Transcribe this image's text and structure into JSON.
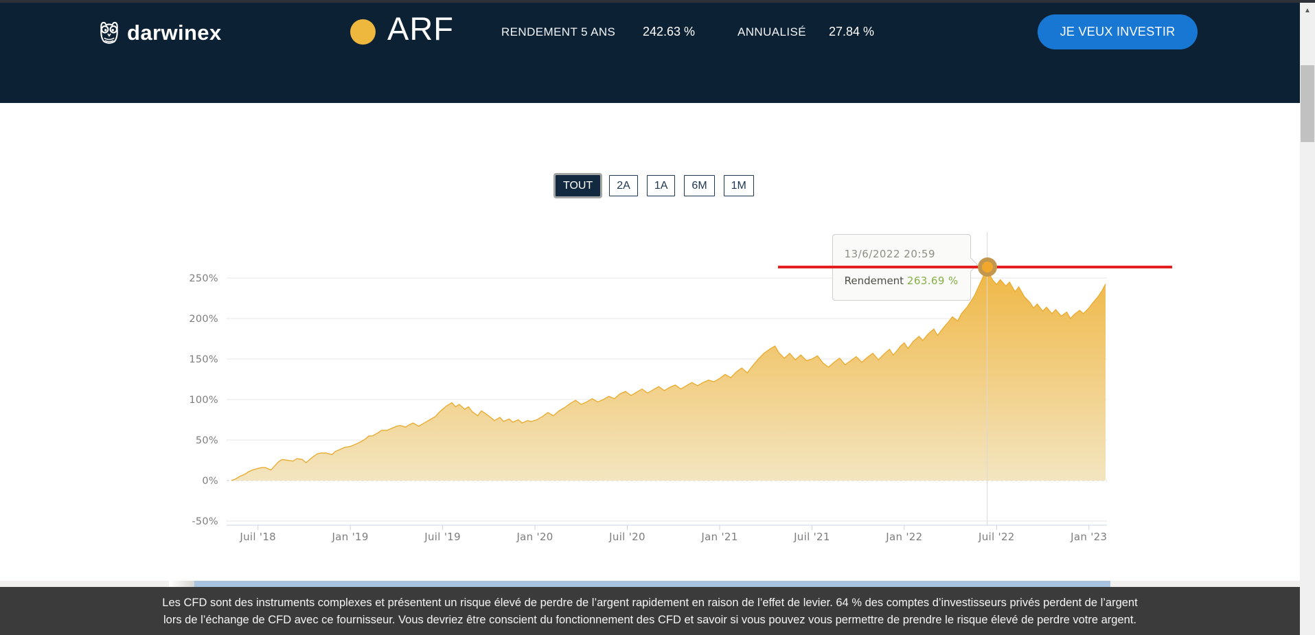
{
  "header": {
    "brand": "darwinex",
    "asset_symbol": "ARF",
    "stats": [
      {
        "label": "RENDEMENT 5 ANS",
        "value": "242.63 %"
      },
      {
        "label": "ANNUALISÉ",
        "value": "27.84 %"
      }
    ],
    "invest_button": "JE VEUX INVESTIR",
    "colors": {
      "header_bg": "#0d2134",
      "accent_gold": "#eeb73d",
      "button_blue": "#1877d2"
    }
  },
  "range_buttons": [
    {
      "label": "TOUT",
      "active": true
    },
    {
      "label": "2A",
      "active": false
    },
    {
      "label": "1A",
      "active": false
    },
    {
      "label": "6M",
      "active": false
    },
    {
      "label": "1M",
      "active": false
    }
  ],
  "chart_data": {
    "type": "area",
    "title": "",
    "xlabel": "",
    "ylabel": "",
    "grid": "horizontal",
    "zero_line": "dashed",
    "legend": "none",
    "ylim": [
      -55,
      305
    ],
    "x_axis": {
      "ticks": [
        {
          "t": 2018.5,
          "label": "Juil '18"
        },
        {
          "t": 2019.0,
          "label": "Jan '19"
        },
        {
          "t": 2019.5,
          "label": "Juil '19"
        },
        {
          "t": 2020.0,
          "label": "Jan '20"
        },
        {
          "t": 2020.5,
          "label": "Juil '20"
        },
        {
          "t": 2021.0,
          "label": "Jan '21"
        },
        {
          "t": 2021.5,
          "label": "Juil '21"
        },
        {
          "t": 2022.0,
          "label": "Jan '22"
        },
        {
          "t": 2022.5,
          "label": "Juil '22"
        },
        {
          "t": 2023.0,
          "label": "Jan '23"
        }
      ]
    },
    "y_axis": {
      "unit": "%",
      "ticks": [
        {
          "v": 250,
          "label": "250%"
        },
        {
          "v": 200,
          "label": "200%"
        },
        {
          "v": 150,
          "label": "150%"
        },
        {
          "v": 100,
          "label": "100%"
        },
        {
          "v": 50,
          "label": "50%"
        },
        {
          "v": 0,
          "label": "0%"
        },
        {
          "v": -50,
          "label": "-50%"
        }
      ]
    },
    "series": [
      {
        "name": "Rendement",
        "color": "#EEB73D",
        "points": [
          [
            2018.355,
            0
          ],
          [
            2018.38,
            2
          ],
          [
            2018.4,
            5
          ],
          [
            2018.43,
            8
          ],
          [
            2018.45,
            11
          ],
          [
            2018.47,
            13
          ],
          [
            2018.5,
            15
          ],
          [
            2018.52,
            16
          ],
          [
            2018.54,
            16
          ],
          [
            2018.57,
            13
          ],
          [
            2018.59,
            18
          ],
          [
            2018.61,
            23
          ],
          [
            2018.63,
            26
          ],
          [
            2018.66,
            25
          ],
          [
            2018.69,
            24
          ],
          [
            2018.71,
            27
          ],
          [
            2018.74,
            26
          ],
          [
            2018.76,
            22
          ],
          [
            2018.79,
            28
          ],
          [
            2018.82,
            33
          ],
          [
            2018.84,
            34
          ],
          [
            2018.87,
            34
          ],
          [
            2018.9,
            32
          ],
          [
            2018.92,
            36
          ],
          [
            2018.95,
            39
          ],
          [
            2018.97,
            41
          ],
          [
            2019.0,
            42
          ],
          [
            2019.03,
            45
          ],
          [
            2019.05,
            47
          ],
          [
            2019.08,
            51
          ],
          [
            2019.1,
            55
          ],
          [
            2019.12,
            55
          ],
          [
            2019.15,
            59
          ],
          [
            2019.17,
            62
          ],
          [
            2019.2,
            62
          ],
          [
            2019.23,
            65
          ],
          [
            2019.25,
            67
          ],
          [
            2019.27,
            68
          ],
          [
            2019.3,
            66
          ],
          [
            2019.32,
            69
          ],
          [
            2019.34,
            71
          ],
          [
            2019.37,
            67
          ],
          [
            2019.4,
            71
          ],
          [
            2019.43,
            75
          ],
          [
            2019.46,
            79
          ],
          [
            2019.48,
            84
          ],
          [
            2019.5,
            88
          ],
          [
            2019.52,
            92
          ],
          [
            2019.55,
            96
          ],
          [
            2019.57,
            91
          ],
          [
            2019.59,
            94
          ],
          [
            2019.62,
            88
          ],
          [
            2019.64,
            91
          ],
          [
            2019.66,
            85
          ],
          [
            2019.69,
            80
          ],
          [
            2019.71,
            86
          ],
          [
            2019.73,
            83
          ],
          [
            2019.76,
            78
          ],
          [
            2019.78,
            74
          ],
          [
            2019.81,
            78
          ],
          [
            2019.83,
            73
          ],
          [
            2019.86,
            76
          ],
          [
            2019.88,
            72
          ],
          [
            2019.91,
            75
          ],
          [
            2019.93,
            71
          ],
          [
            2019.96,
            74
          ],
          [
            2019.98,
            73
          ],
          [
            2020.01,
            75
          ],
          [
            2020.04,
            79
          ],
          [
            2020.07,
            84
          ],
          [
            2020.1,
            80
          ],
          [
            2020.13,
            86
          ],
          [
            2020.16,
            90
          ],
          [
            2020.19,
            95
          ],
          [
            2020.22,
            99
          ],
          [
            2020.25,
            94
          ],
          [
            2020.28,
            97
          ],
          [
            2020.31,
            101
          ],
          [
            2020.34,
            97
          ],
          [
            2020.37,
            100
          ],
          [
            2020.4,
            104
          ],
          [
            2020.43,
            101
          ],
          [
            2020.46,
            107
          ],
          [
            2020.49,
            110
          ],
          [
            2020.52,
            105
          ],
          [
            2020.55,
            109
          ],
          [
            2020.58,
            113
          ],
          [
            2020.61,
            108
          ],
          [
            2020.64,
            112
          ],
          [
            2020.67,
            116
          ],
          [
            2020.7,
            111
          ],
          [
            2020.73,
            115
          ],
          [
            2020.76,
            118
          ],
          [
            2020.79,
            113
          ],
          [
            2020.82,
            117
          ],
          [
            2020.85,
            121
          ],
          [
            2020.88,
            117
          ],
          [
            2020.91,
            121
          ],
          [
            2020.94,
            124
          ],
          [
            2020.97,
            122
          ],
          [
            2021.0,
            126
          ],
          [
            2021.03,
            131
          ],
          [
            2021.06,
            127
          ],
          [
            2021.09,
            134
          ],
          [
            2021.12,
            139
          ],
          [
            2021.15,
            133
          ],
          [
            2021.18,
            142
          ],
          [
            2021.21,
            150
          ],
          [
            2021.24,
            157
          ],
          [
            2021.27,
            162
          ],
          [
            2021.3,
            166
          ],
          [
            2021.32,
            158
          ],
          [
            2021.35,
            151
          ],
          [
            2021.38,
            157
          ],
          [
            2021.41,
            149
          ],
          [
            2021.44,
            155
          ],
          [
            2021.47,
            148
          ],
          [
            2021.5,
            150
          ],
          [
            2021.53,
            154
          ],
          [
            2021.56,
            145
          ],
          [
            2021.59,
            140
          ],
          [
            2021.62,
            146
          ],
          [
            2021.65,
            151
          ],
          [
            2021.68,
            143
          ],
          [
            2021.71,
            148
          ],
          [
            2021.74,
            153
          ],
          [
            2021.77,
            146
          ],
          [
            2021.8,
            152
          ],
          [
            2021.83,
            157
          ],
          [
            2021.86,
            149
          ],
          [
            2021.89,
            156
          ],
          [
            2021.92,
            162
          ],
          [
            2021.94,
            155
          ],
          [
            2021.96,
            160
          ],
          [
            2021.98,
            166
          ],
          [
            2022.0,
            170
          ],
          [
            2022.02,
            163
          ],
          [
            2022.05,
            172
          ],
          [
            2022.08,
            178
          ],
          [
            2022.1,
            173
          ],
          [
            2022.13,
            181
          ],
          [
            2022.16,
            187
          ],
          [
            2022.18,
            179
          ],
          [
            2022.21,
            188
          ],
          [
            2022.24,
            196
          ],
          [
            2022.26,
            202
          ],
          [
            2022.29,
            197
          ],
          [
            2022.31,
            206
          ],
          [
            2022.34,
            214
          ],
          [
            2022.36,
            221
          ],
          [
            2022.38,
            228
          ],
          [
            2022.4,
            238
          ],
          [
            2022.42,
            248
          ],
          [
            2022.44,
            258
          ],
          [
            2022.449,
            263.69
          ],
          [
            2022.46,
            255
          ],
          [
            2022.48,
            247
          ],
          [
            2022.5,
            242
          ],
          [
            2022.52,
            248
          ],
          [
            2022.55,
            240
          ],
          [
            2022.57,
            245
          ],
          [
            2022.6,
            233
          ],
          [
            2022.62,
            239
          ],
          [
            2022.65,
            227
          ],
          [
            2022.68,
            220
          ],
          [
            2022.7,
            213
          ],
          [
            2022.72,
            218
          ],
          [
            2022.75,
            209
          ],
          [
            2022.77,
            214
          ],
          [
            2022.8,
            206
          ],
          [
            2022.82,
            211
          ],
          [
            2022.85,
            203
          ],
          [
            2022.88,
            208
          ],
          [
            2022.9,
            200
          ],
          [
            2022.92,
            205
          ],
          [
            2022.95,
            210
          ],
          [
            2022.97,
            206
          ],
          [
            2023.0,
            213
          ],
          [
            2023.02,
            219
          ],
          [
            2023.05,
            227
          ],
          [
            2023.07,
            234
          ],
          [
            2023.09,
            242.63
          ]
        ]
      }
    ],
    "tooltip": {
      "date": "13/6/2022 20:59",
      "label": "Rendement",
      "value": "263.69 %",
      "value_num": 263.69,
      "t": 2022.449
    },
    "annotation_line": {
      "value": 263.69,
      "color": "#e3201f"
    },
    "last_value": 242.63,
    "colors": {
      "area_top": "#f0b94a",
      "area_bottom": "#f3e5c0",
      "line": "#ebac33",
      "green_value": "#84b043"
    }
  },
  "disclaimer": {
    "line1": "Les CFD sont des instruments complexes et présentent un risque élevé de perdre de l’argent rapidement en raison de l’effet de levier. 64 % des comptes d’investisseurs privés perdent de l’argent",
    "line2": "lors de l’échange de CFD avec ce fournisseur. Vous devriez être conscient du fonctionnement des CFD et savoir si vous pouvez vous permettre de prendre le risque élevé de perdre votre argent."
  }
}
